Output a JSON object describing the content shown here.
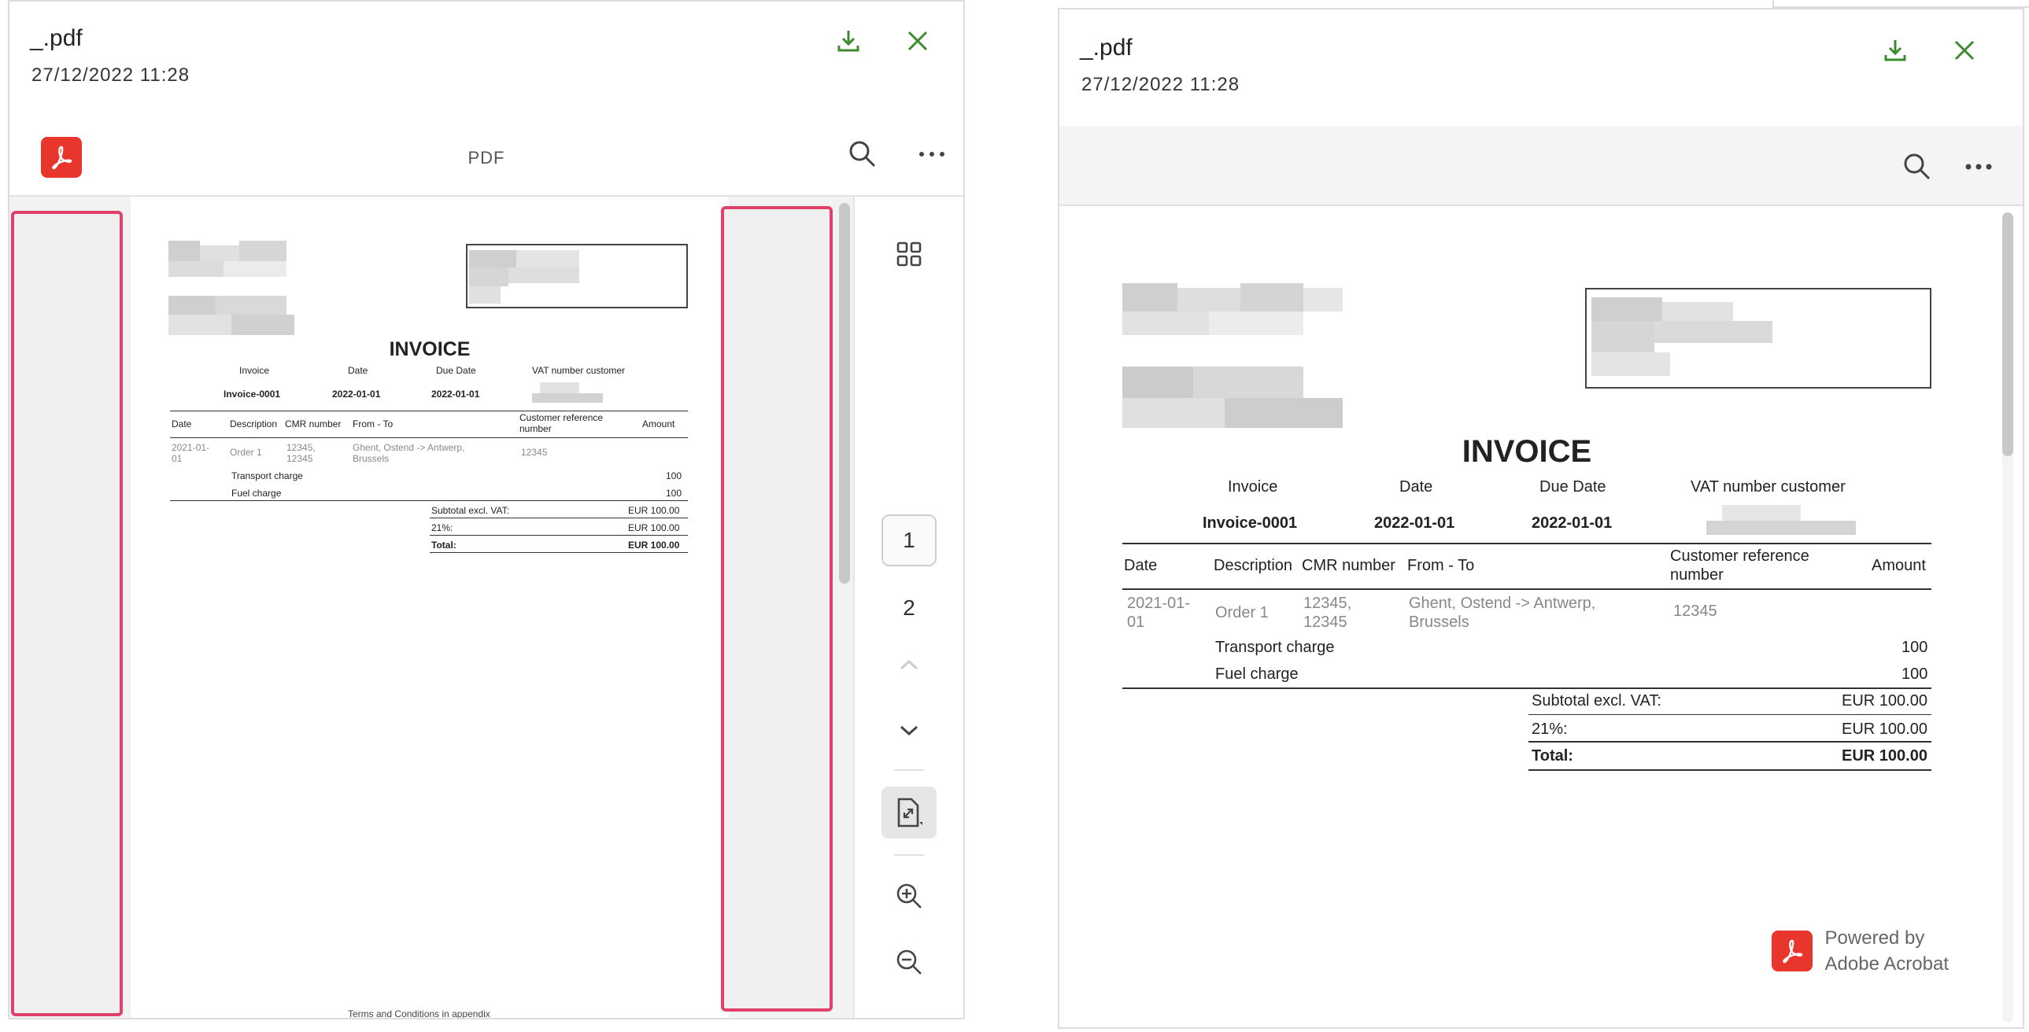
{
  "file": {
    "name": "_.pdf",
    "date": "27/12/2022 11:28"
  },
  "toolbar": {
    "title": "PDF"
  },
  "icons": {
    "download": "download-icon",
    "close": "close-icon",
    "search": "search-icon",
    "more": "more-icon",
    "acrobat": "acrobat-logo-icon",
    "grid": "grid-icon",
    "up": "chevron-up-icon",
    "down": "chevron-down-icon",
    "fit": "fit-page-icon",
    "zoom_in": "zoom-in-icon",
    "zoom_out": "zoom-out-icon"
  },
  "colors": {
    "accent_green": "#3d8b2e",
    "acrobat_red": "#e8362d",
    "highlight_pink": "#e0416a"
  },
  "pages": {
    "current": "1",
    "next": "2"
  },
  "invoice": {
    "title": "INVOICE",
    "meta_headers": [
      "Invoice",
      "Date",
      "Due Date",
      "VAT number customer"
    ],
    "meta_values": [
      "Invoice-0001",
      "2022-01-01",
      "2022-01-01"
    ],
    "table_headers": {
      "date": "Date",
      "description": "Description",
      "cmr": "CMR number",
      "fromto": "From - To",
      "custref_1": "Customer reference",
      "custref_2": "number",
      "amount": "Amount"
    },
    "row": {
      "date_1": "2021-01-",
      "date_2": "01",
      "description": "Order 1",
      "cmr_1": "12345,",
      "cmr_2": "12345",
      "route_1": "Ghent, Ostend -> Antwerp,",
      "route_2": "Brussels",
      "custref": "12345"
    },
    "charges": [
      {
        "label": "Transport charge",
        "amount": "100"
      },
      {
        "label": "Fuel charge",
        "amount": "100"
      }
    ],
    "totals": [
      {
        "label": "Subtotal excl. VAT:",
        "value": "EUR 100.00"
      },
      {
        "label": "21%:",
        "value": "EUR 100.00"
      },
      {
        "label": "Total:",
        "value": "EUR 100.00"
      }
    ],
    "footer_note": "Terms and Conditions in appendix"
  },
  "powered_by": {
    "line1": "Powered by",
    "line2": "Adobe Acrobat"
  }
}
